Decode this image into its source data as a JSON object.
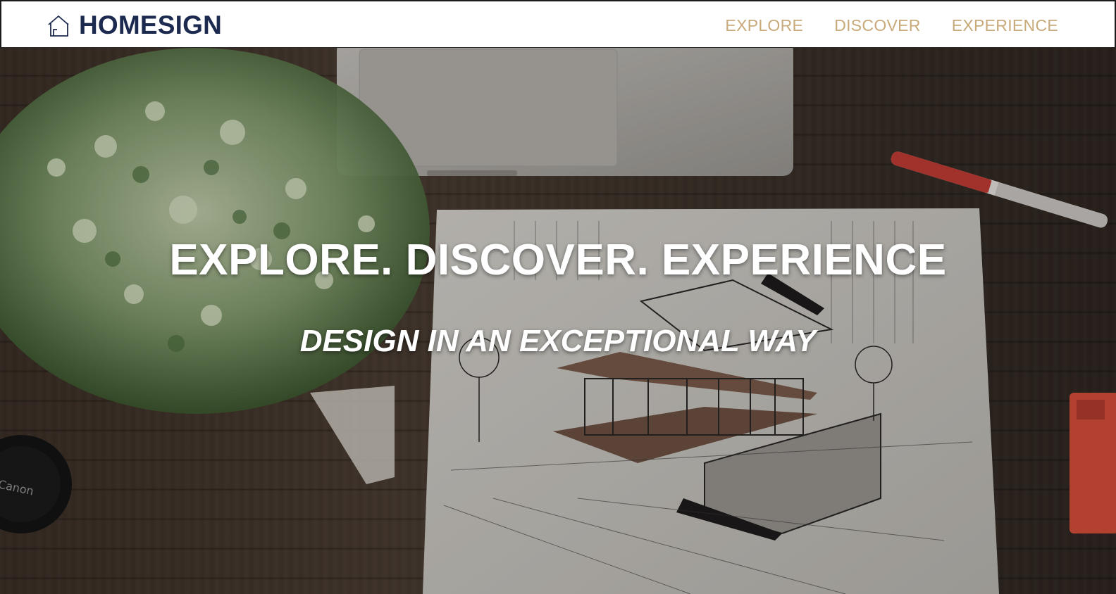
{
  "header": {
    "brand_name": "HOMESIGN",
    "brand_icon": "house-outline-icon",
    "nav": [
      {
        "label": "EXPLORE"
      },
      {
        "label": "DISCOVER"
      },
      {
        "label": "EXPERIENCE"
      }
    ],
    "brand_color": "#1c2a4f",
    "nav_color": "#c8a97a"
  },
  "hero": {
    "title": "EXPLORE. DISCOVER. EXPERIENCE",
    "subtitle": "DESIGN IN AN EXCEPTIONAL WAY",
    "background_description_icon": "architect-desk-photo",
    "camera_cap_text": "Canon"
  }
}
